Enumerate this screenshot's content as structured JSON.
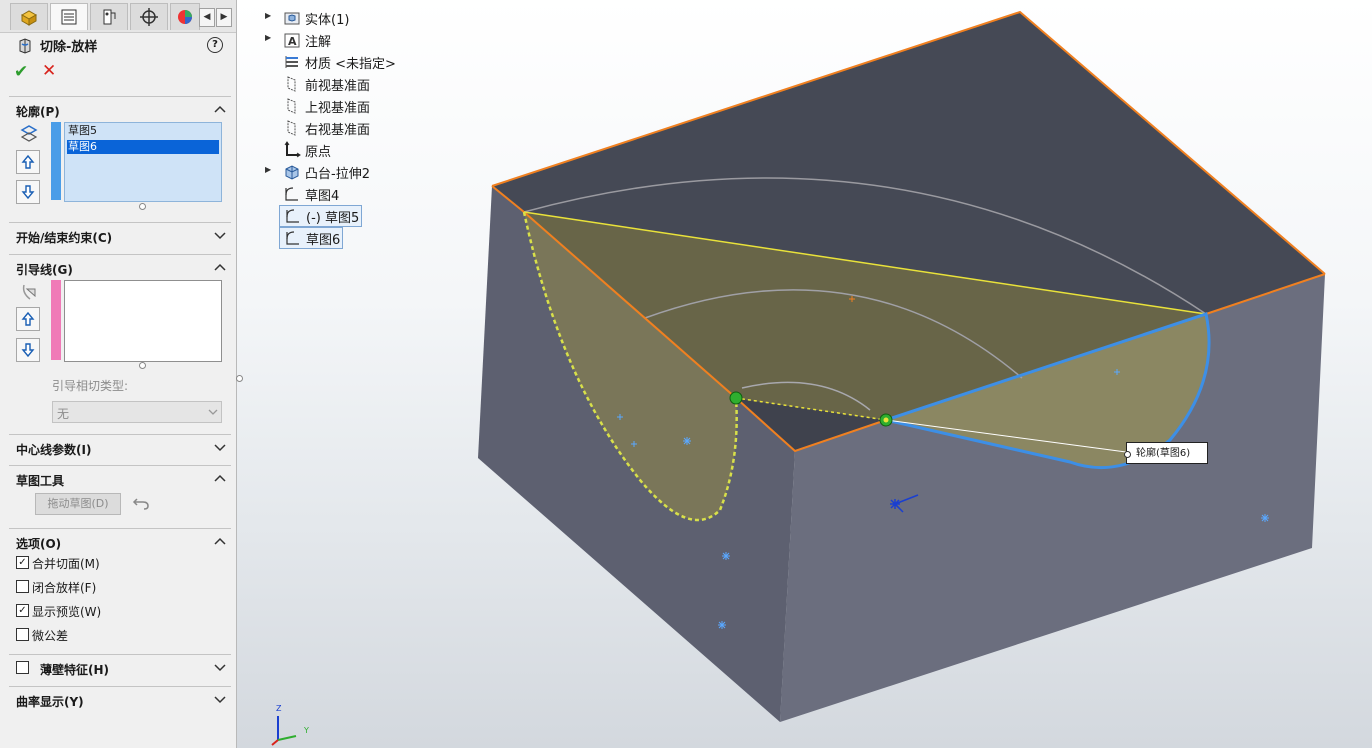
{
  "panel": {
    "title": "切除-放样",
    "help_label": "?",
    "ok_symbol": "✔",
    "cancel_symbol": "✕",
    "tabs": [
      "feature-manager-icon",
      "property-manager-icon",
      "configuration-manager-icon",
      "dimxpert-icon",
      "display-manager-icon"
    ],
    "profile": {
      "label": "轮廓(P)",
      "items": [
        "草图5",
        "草图6"
      ],
      "selected_index": 1
    },
    "start_end": {
      "label": "开始/结束约束(C)"
    },
    "guides": {
      "label": "引导线(G)",
      "tangency_label": "引导相切类型:",
      "tangency_value": "无"
    },
    "centerline": {
      "label": "中心线参数(I)"
    },
    "sketch_tools": {
      "label": "草图工具",
      "drag_button": "拖动草图(D)"
    },
    "options": {
      "label": "选项(O)",
      "items": [
        {
          "label": "合并切面(M)",
          "checked": true
        },
        {
          "label": "闭合放样(F)",
          "checked": false
        },
        {
          "label": "显示预览(W)",
          "checked": true
        },
        {
          "label": "微公差",
          "checked": false
        }
      ]
    },
    "thin": {
      "label": "薄壁特征(H)",
      "checked": false
    },
    "curvature": {
      "label": "曲率显示(Y)"
    }
  },
  "tree": {
    "items": [
      {
        "label": "实体(1)",
        "expandable": true
      },
      {
        "label": "注解",
        "expandable": true
      },
      {
        "label": "材质 <未指定>",
        "expandable": false
      },
      {
        "label": "前视基准面",
        "expandable": false
      },
      {
        "label": "上视基准面",
        "expandable": false
      },
      {
        "label": "右视基准面",
        "expandable": false
      },
      {
        "label": "原点",
        "expandable": false
      },
      {
        "label": "凸台-拉伸2",
        "expandable": true
      },
      {
        "label": "草图4",
        "expandable": false
      },
      {
        "label": "(-) 草图5",
        "expandable": false
      },
      {
        "label": "草图6",
        "expandable": false
      }
    ]
  },
  "viewport": {
    "tooltip": "轮廓(草图6)",
    "triad": {
      "z": "Z",
      "y": "Y"
    }
  },
  "colors": {
    "accent_blue": "#3d8fe6",
    "edge_orange": "#f08020",
    "top_face": "#474b57",
    "front_face": "#6c6f80",
    "preview_fill": "#8f8a5f"
  }
}
